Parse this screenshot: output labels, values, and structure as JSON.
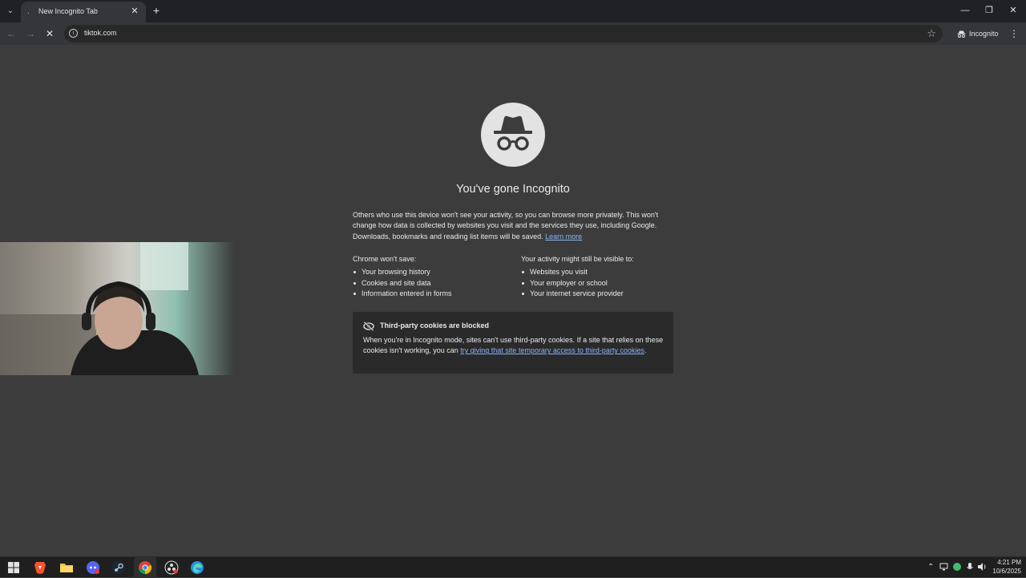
{
  "browser": {
    "tab": {
      "title": "New Incognito Tab"
    },
    "address_bar": {
      "url": "tiktok.com"
    },
    "profile_chip": {
      "label": "Incognito"
    }
  },
  "page": {
    "heading": "You've gone Incognito",
    "intro_text": "Others who use this device won't see your activity, so you can browse more privately. This won't change how data is collected by websites you visit and the services they use, including Google. Downloads, bookmarks and reading list items will be saved.",
    "learn_more": "Learn more",
    "wont_save": {
      "title": "Chrome won't save:",
      "items": [
        "Your browsing history",
        "Cookies and site data",
        "Information entered in forms"
      ]
    },
    "might_be_visible": {
      "title": "Your activity might still be visible to:",
      "items": [
        "Websites you visit",
        "Your employer or school",
        "Your internet service provider"
      ]
    },
    "cookies_card": {
      "title": "Third-party cookies are blocked",
      "body_prefix": "When you're in Incognito mode, sites can't use third-party cookies. If a site that relies on these cookies isn't working, you can ",
      "link": "try giving that site temporary access to third-party cookies",
      "body_suffix": "."
    }
  },
  "taskbar": {
    "apps": [
      "start-icon",
      "brave-icon",
      "file-explorer-icon",
      "discord-icon",
      "steam-icon",
      "chrome-icon",
      "obs-icon",
      "edge-icon"
    ],
    "clock": {
      "time": "4:21 PM",
      "date": "10/6/2025"
    }
  },
  "colors": {
    "page_bg": "#3c3c3c",
    "tabstrip_bg": "#202124",
    "toolbar_bg": "#35363a",
    "card_bg": "#2a2a2a",
    "link": "#8ab4f8",
    "text": "#e8eaed"
  }
}
